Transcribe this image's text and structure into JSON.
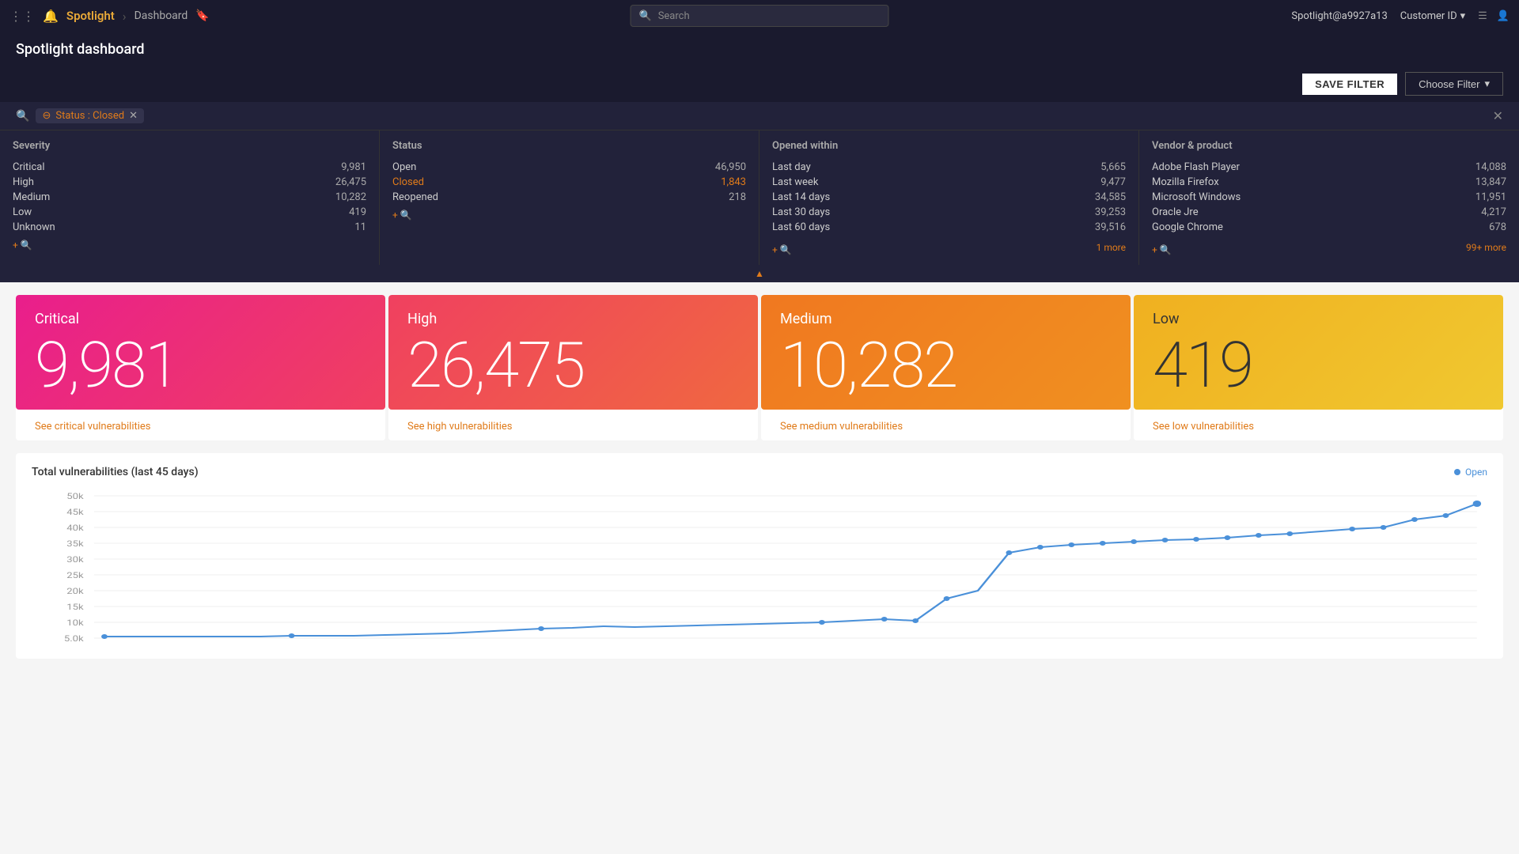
{
  "nav": {
    "brand": "Spotlight",
    "breadcrumb": "Dashboard",
    "search_placeholder": "Search",
    "user": "Spotlight@a9927a13",
    "customer_id": "Customer ID"
  },
  "toolbar": {
    "save_filter": "SAVE FILTER",
    "choose_filter": "Choose Filter"
  },
  "filter": {
    "tag_label": "Status : Closed",
    "tag_prefix": "Status :",
    "tag_value": "Closed"
  },
  "facets": {
    "severity": {
      "title": "Severity",
      "items": [
        {
          "label": "Critical",
          "count": "9,981"
        },
        {
          "label": "High",
          "count": "26,475"
        },
        {
          "label": "Medium",
          "count": "10,282"
        },
        {
          "label": "Low",
          "count": "419"
        },
        {
          "label": "Unknown",
          "count": "11"
        }
      ],
      "more_label": "+🔍"
    },
    "status": {
      "title": "Status",
      "items": [
        {
          "label": "Open",
          "count": "46,950",
          "active": false
        },
        {
          "label": "Closed",
          "count": "1,843",
          "active": true
        },
        {
          "label": "Reopened",
          "count": "218",
          "active": false
        }
      ],
      "more_label": "+🔍"
    },
    "opened_within": {
      "title": "Opened within",
      "items": [
        {
          "label": "Last day",
          "count": "5,665"
        },
        {
          "label": "Last week",
          "count": "9,477"
        },
        {
          "label": "Last 14 days",
          "count": "34,585"
        },
        {
          "label": "Last 30 days",
          "count": "39,253"
        },
        {
          "label": "Last 60 days",
          "count": "39,516"
        }
      ],
      "more_label": "1 more"
    },
    "vendor_product": {
      "title": "Vendor & product",
      "items": [
        {
          "label": "Adobe Flash Player",
          "count": "14,088"
        },
        {
          "label": "Mozilla Firefox",
          "count": "13,847"
        },
        {
          "label": "Microsoft Windows",
          "count": "11,951"
        },
        {
          "label": "Oracle Jre",
          "count": "4,217"
        },
        {
          "label": "Google Chrome",
          "count": "678"
        }
      ],
      "more_label": "99+ more"
    }
  },
  "severity_cards": [
    {
      "id": "critical",
      "label": "Critical",
      "count": "9,981",
      "link": "See critical vulnerabilities"
    },
    {
      "id": "high",
      "label": "High",
      "count": "26,475",
      "link": "See high vulnerabilities"
    },
    {
      "id": "medium",
      "label": "Medium",
      "count": "10,282",
      "link": "See medium vulnerabilities"
    },
    {
      "id": "low",
      "label": "Low",
      "count": "419",
      "link": "See low vulnerabilities"
    }
  ],
  "chart": {
    "title": "Total vulnerabilities (last 45 days)",
    "legend_label": "Open",
    "y_labels": [
      "50k",
      "45k",
      "40k",
      "35k",
      "30k",
      "25k",
      "20k",
      "15k",
      "10k",
      "5.0k"
    ]
  },
  "page_title": "Spotlight dashboard"
}
